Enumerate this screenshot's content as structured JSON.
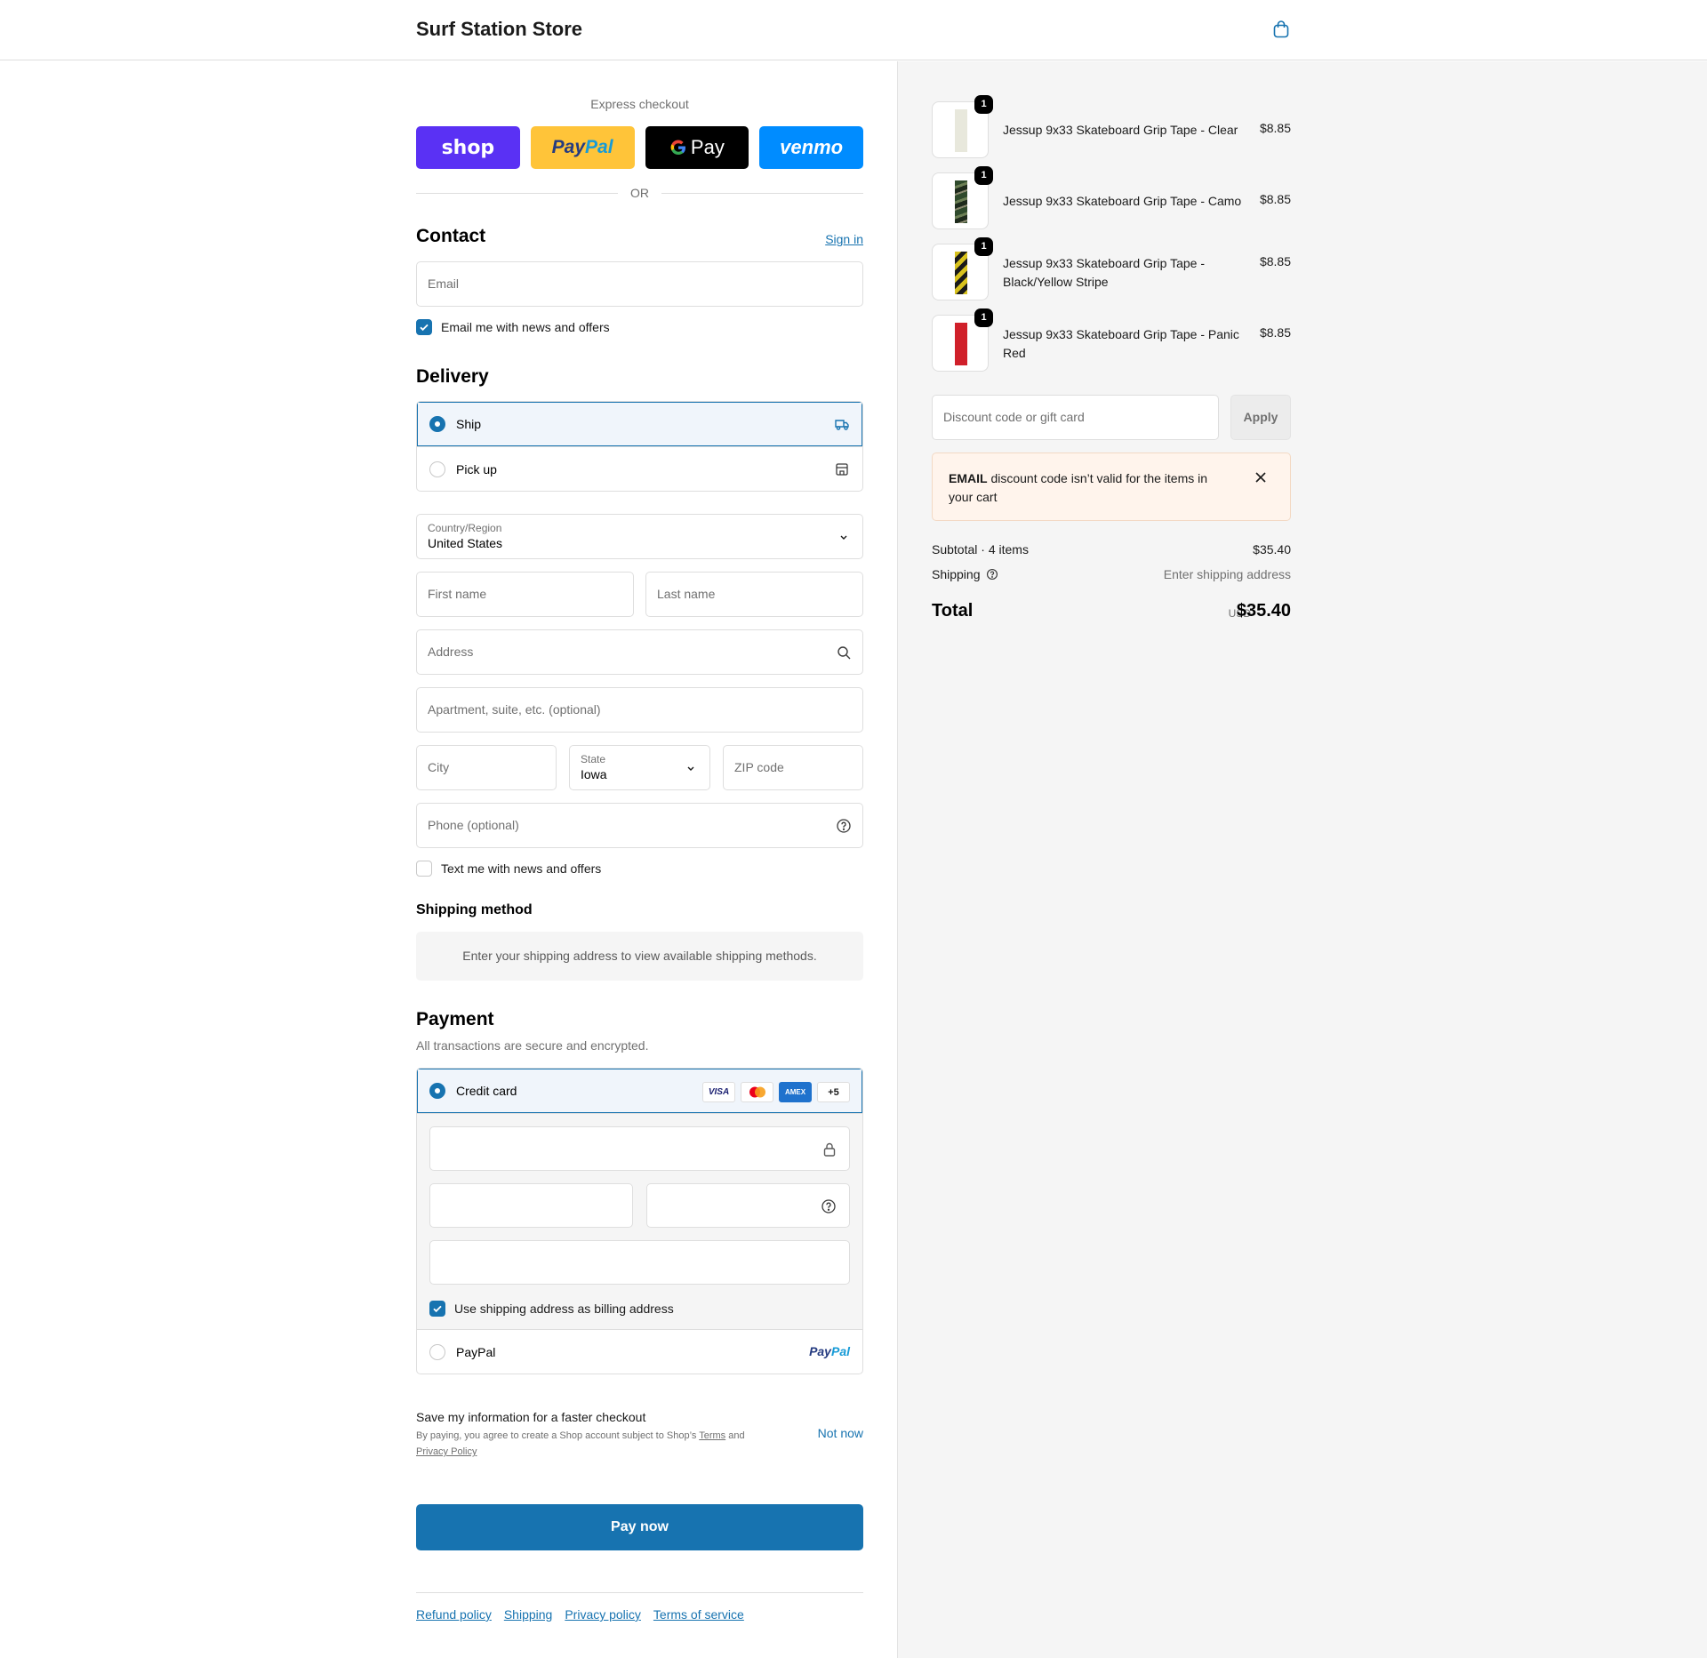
{
  "store": {
    "name": "Surf Station Store"
  },
  "express": {
    "label": "Express checkout",
    "shop": "shop",
    "paypal_a": "Pay",
    "paypal_b": "Pal",
    "gpay": "Pay",
    "venmo": "venmo",
    "or": "OR"
  },
  "contact": {
    "heading": "Contact",
    "sign_in": "Sign in",
    "email_placeholder": "Email",
    "email_news": "Email me with news and offers"
  },
  "delivery": {
    "heading": "Delivery",
    "options": [
      {
        "label": "Ship",
        "selected": true,
        "icon": "truck-icon"
      },
      {
        "label": "Pick up",
        "selected": false,
        "icon": "store-icon"
      }
    ],
    "country_label": "Country/Region",
    "country_value": "United States",
    "first_name": "First name",
    "last_name": "Last name",
    "address": "Address",
    "apartment": "Apartment, suite, etc. (optional)",
    "city": "City",
    "state_label": "State",
    "state_value": "Iowa",
    "zip": "ZIP code",
    "phone": "Phone (optional)",
    "text_news": "Text me with news and offers"
  },
  "shipping_method": {
    "heading": "Shipping method",
    "message": "Enter your shipping address to view available shipping methods."
  },
  "payment": {
    "heading": "Payment",
    "subtitle": "All transactions are secure and encrypted.",
    "credit_card": "Credit card",
    "cards": [
      "VISA",
      "",
      "AMEX",
      "+5"
    ],
    "billing_same": "Use shipping address as billing address",
    "paypal": "PayPal",
    "paypal_logo_a": "Pay",
    "paypal_logo_b": "Pal"
  },
  "save_info": {
    "title": "Save my information for a faster checkout",
    "desc_pre": "By paying, you agree to create a Shop account subject to Shop’s ",
    "terms": "Terms",
    "and": " and",
    "privacy": "Privacy Policy",
    "not_now": "Not now"
  },
  "pay_now": "Pay now",
  "footer_links": [
    "Refund policy",
    "Shipping",
    "Privacy policy",
    "Terms of service"
  ],
  "cart": {
    "items": [
      {
        "name": "Jessup 9x33 Skateboard Grip Tape - Clear",
        "price": "$8.85",
        "qty": "1",
        "color": "#e8e8dc"
      },
      {
        "name": "Jessup 9x33 Skateboard Grip Tape - Camo",
        "price": "$8.85",
        "qty": "1",
        "color": "#3e5a3a"
      },
      {
        "name": "Jessup 9x33 Skateboard Grip Tape - Black/Yellow Stripe",
        "price": "$8.85",
        "qty": "1",
        "color": "#d8c21e"
      },
      {
        "name": "Jessup 9x33 Skateboard Grip Tape - Panic Red",
        "price": "$8.85",
        "qty": "1",
        "color": "#d0202a"
      }
    ],
    "discount_placeholder": "Discount code or gift card",
    "apply": "Apply",
    "alert_bold": "EMAIL",
    "alert_text": " discount code isn’t valid for the items in your cart",
    "subtotal_label": "Subtotal · 4 items",
    "subtotal_value": "$35.40",
    "shipping_label": "Shipping",
    "shipping_value": "Enter shipping address",
    "total_label": "Total",
    "total_currency": "USD",
    "total_value": "$35.40"
  },
  "colors": {
    "accent": "#1773b0",
    "shop": "#5a31f4",
    "paypal": "#ffc439",
    "venmo": "#008cff"
  }
}
